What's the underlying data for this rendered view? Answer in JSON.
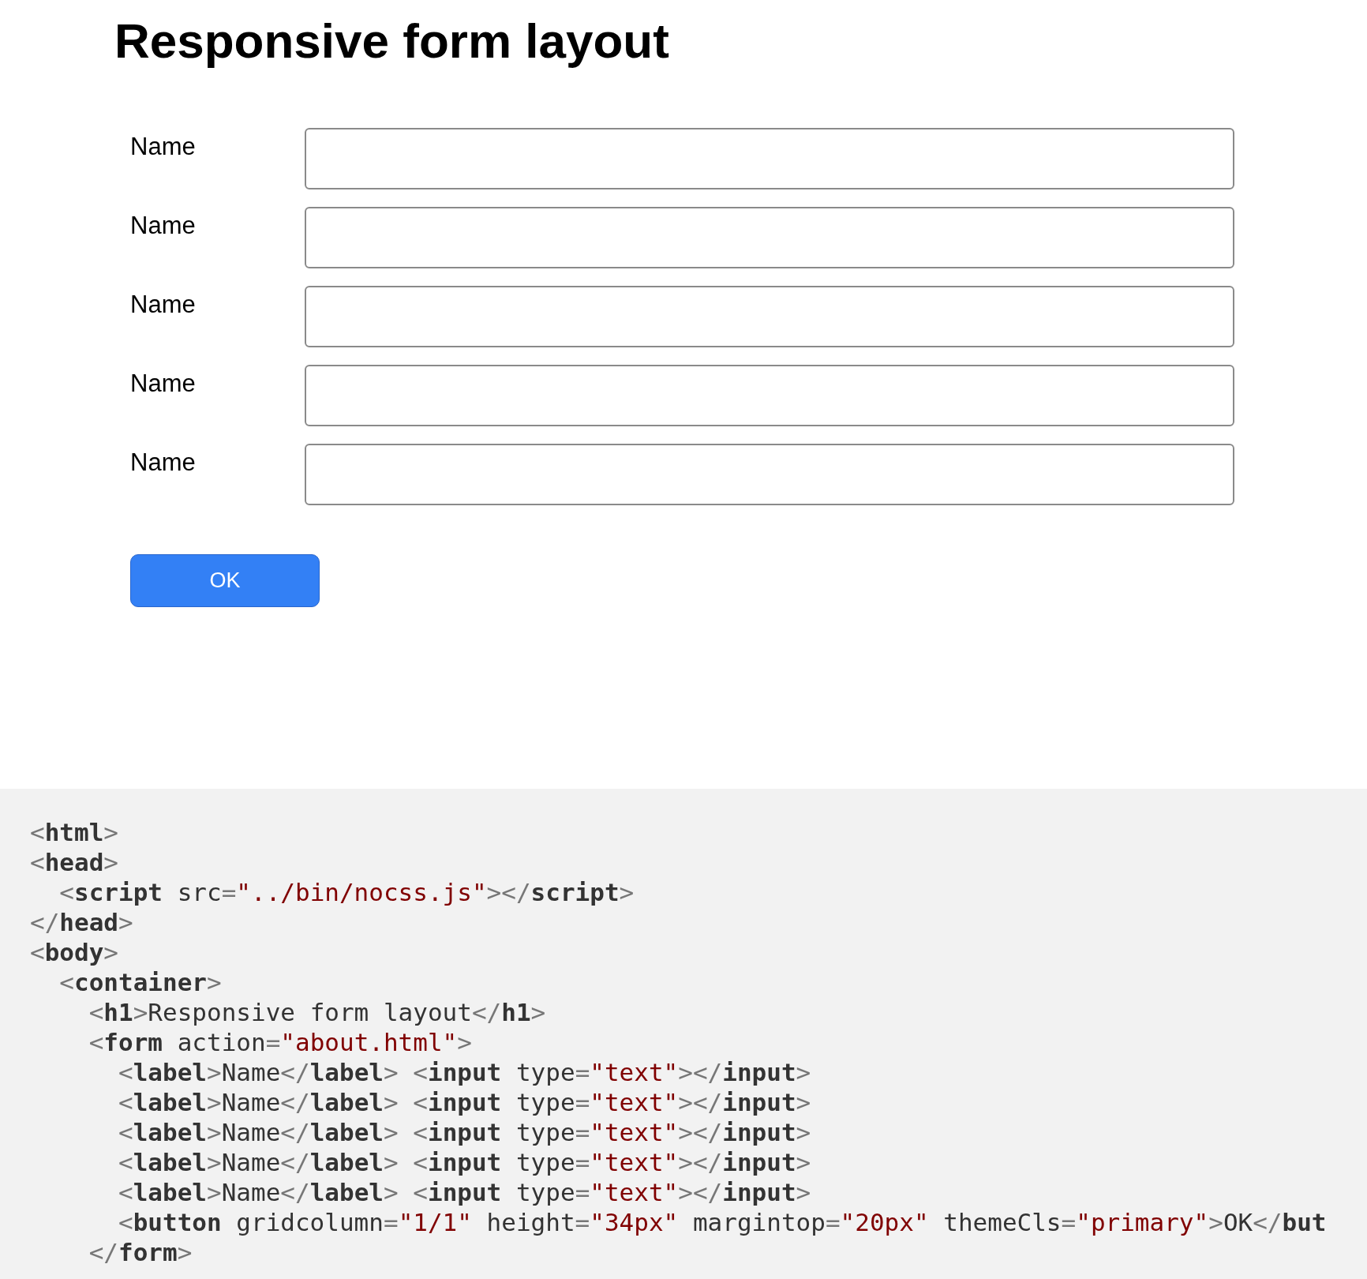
{
  "title": "Responsive form layout",
  "form": {
    "fields": [
      {
        "label": "Name"
      },
      {
        "label": "Name"
      },
      {
        "label": "Name"
      },
      {
        "label": "Name"
      },
      {
        "label": "Name"
      }
    ],
    "button": {
      "label": "OK"
    }
  },
  "code": {
    "lines": [
      [
        {
          "kind": "punct",
          "text": "<"
        },
        {
          "kind": "tag",
          "text": "html"
        },
        {
          "kind": "punct",
          "text": ">"
        }
      ],
      [
        {
          "kind": "punct",
          "text": "<"
        },
        {
          "kind": "tag",
          "text": "head"
        },
        {
          "kind": "punct",
          "text": ">"
        }
      ],
      [
        {
          "kind": "punct",
          "text": "  <"
        },
        {
          "kind": "tag",
          "text": "script"
        },
        {
          "kind": "attr",
          "text": " src"
        },
        {
          "kind": "punct",
          "text": "="
        },
        {
          "kind": "string",
          "text": "\"../bin/nocss.js\""
        },
        {
          "kind": "punct",
          "text": "></"
        },
        {
          "kind": "tag",
          "text": "script"
        },
        {
          "kind": "punct",
          "text": ">"
        }
      ],
      [
        {
          "kind": "punct",
          "text": "</"
        },
        {
          "kind": "tag",
          "text": "head"
        },
        {
          "kind": "punct",
          "text": ">"
        }
      ],
      [
        {
          "kind": "punct",
          "text": "<"
        },
        {
          "kind": "tag",
          "text": "body"
        },
        {
          "kind": "punct",
          "text": ">"
        }
      ],
      [
        {
          "kind": "punct",
          "text": "  <"
        },
        {
          "kind": "tag",
          "text": "container"
        },
        {
          "kind": "punct",
          "text": ">"
        }
      ],
      [
        {
          "kind": "punct",
          "text": "    <"
        },
        {
          "kind": "tag",
          "text": "h1"
        },
        {
          "kind": "punct",
          "text": ">"
        },
        {
          "kind": "text",
          "text": "Responsive form layout"
        },
        {
          "kind": "punct",
          "text": "</"
        },
        {
          "kind": "tag",
          "text": "h1"
        },
        {
          "kind": "punct",
          "text": ">"
        }
      ],
      [
        {
          "kind": "punct",
          "text": "    <"
        },
        {
          "kind": "tag",
          "text": "form"
        },
        {
          "kind": "attr",
          "text": " action"
        },
        {
          "kind": "punct",
          "text": "="
        },
        {
          "kind": "string",
          "text": "\"about.html\""
        },
        {
          "kind": "punct",
          "text": ">"
        }
      ],
      [
        {
          "kind": "punct",
          "text": "      <"
        },
        {
          "kind": "tag",
          "text": "label"
        },
        {
          "kind": "punct",
          "text": ">"
        },
        {
          "kind": "text",
          "text": "Name"
        },
        {
          "kind": "punct",
          "text": "</"
        },
        {
          "kind": "tag",
          "text": "label"
        },
        {
          "kind": "punct",
          "text": "> <"
        },
        {
          "kind": "tag",
          "text": "input"
        },
        {
          "kind": "attr",
          "text": " type"
        },
        {
          "kind": "punct",
          "text": "="
        },
        {
          "kind": "string",
          "text": "\"text\""
        },
        {
          "kind": "punct",
          "text": "></"
        },
        {
          "kind": "tag",
          "text": "input"
        },
        {
          "kind": "punct",
          "text": ">"
        }
      ],
      [
        {
          "kind": "punct",
          "text": "      <"
        },
        {
          "kind": "tag",
          "text": "label"
        },
        {
          "kind": "punct",
          "text": ">"
        },
        {
          "kind": "text",
          "text": "Name"
        },
        {
          "kind": "punct",
          "text": "</"
        },
        {
          "kind": "tag",
          "text": "label"
        },
        {
          "kind": "punct",
          "text": "> <"
        },
        {
          "kind": "tag",
          "text": "input"
        },
        {
          "kind": "attr",
          "text": " type"
        },
        {
          "kind": "punct",
          "text": "="
        },
        {
          "kind": "string",
          "text": "\"text\""
        },
        {
          "kind": "punct",
          "text": "></"
        },
        {
          "kind": "tag",
          "text": "input"
        },
        {
          "kind": "punct",
          "text": ">"
        }
      ],
      [
        {
          "kind": "punct",
          "text": "      <"
        },
        {
          "kind": "tag",
          "text": "label"
        },
        {
          "kind": "punct",
          "text": ">"
        },
        {
          "kind": "text",
          "text": "Name"
        },
        {
          "kind": "punct",
          "text": "</"
        },
        {
          "kind": "tag",
          "text": "label"
        },
        {
          "kind": "punct",
          "text": "> <"
        },
        {
          "kind": "tag",
          "text": "input"
        },
        {
          "kind": "attr",
          "text": " type"
        },
        {
          "kind": "punct",
          "text": "="
        },
        {
          "kind": "string",
          "text": "\"text\""
        },
        {
          "kind": "punct",
          "text": "></"
        },
        {
          "kind": "tag",
          "text": "input"
        },
        {
          "kind": "punct",
          "text": ">"
        }
      ],
      [
        {
          "kind": "punct",
          "text": "      <"
        },
        {
          "kind": "tag",
          "text": "label"
        },
        {
          "kind": "punct",
          "text": ">"
        },
        {
          "kind": "text",
          "text": "Name"
        },
        {
          "kind": "punct",
          "text": "</"
        },
        {
          "kind": "tag",
          "text": "label"
        },
        {
          "kind": "punct",
          "text": "> <"
        },
        {
          "kind": "tag",
          "text": "input"
        },
        {
          "kind": "attr",
          "text": " type"
        },
        {
          "kind": "punct",
          "text": "="
        },
        {
          "kind": "string",
          "text": "\"text\""
        },
        {
          "kind": "punct",
          "text": "></"
        },
        {
          "kind": "tag",
          "text": "input"
        },
        {
          "kind": "punct",
          "text": ">"
        }
      ],
      [
        {
          "kind": "punct",
          "text": "      <"
        },
        {
          "kind": "tag",
          "text": "label"
        },
        {
          "kind": "punct",
          "text": ">"
        },
        {
          "kind": "text",
          "text": "Name"
        },
        {
          "kind": "punct",
          "text": "</"
        },
        {
          "kind": "tag",
          "text": "label"
        },
        {
          "kind": "punct",
          "text": "> <"
        },
        {
          "kind": "tag",
          "text": "input"
        },
        {
          "kind": "attr",
          "text": " type"
        },
        {
          "kind": "punct",
          "text": "="
        },
        {
          "kind": "string",
          "text": "\"text\""
        },
        {
          "kind": "punct",
          "text": "></"
        },
        {
          "kind": "tag",
          "text": "input"
        },
        {
          "kind": "punct",
          "text": ">"
        }
      ],
      [
        {
          "kind": "punct",
          "text": "      <"
        },
        {
          "kind": "tag",
          "text": "button"
        },
        {
          "kind": "attr",
          "text": " gridcolumn"
        },
        {
          "kind": "punct",
          "text": "="
        },
        {
          "kind": "string",
          "text": "\"1/1\""
        },
        {
          "kind": "attr",
          "text": " height"
        },
        {
          "kind": "punct",
          "text": "="
        },
        {
          "kind": "string",
          "text": "\"34px\""
        },
        {
          "kind": "attr",
          "text": " margintop"
        },
        {
          "kind": "punct",
          "text": "="
        },
        {
          "kind": "string",
          "text": "\"20px\""
        },
        {
          "kind": "attr",
          "text": " themeCls"
        },
        {
          "kind": "punct",
          "text": "="
        },
        {
          "kind": "string",
          "text": "\"primary\""
        },
        {
          "kind": "punct",
          "text": ">"
        },
        {
          "kind": "text",
          "text": "OK"
        },
        {
          "kind": "punct",
          "text": "</"
        },
        {
          "kind": "tag",
          "text": "but"
        }
      ],
      [
        {
          "kind": "punct",
          "text": "    </"
        },
        {
          "kind": "tag",
          "text": "form"
        },
        {
          "kind": "punct",
          "text": ">"
        }
      ]
    ]
  }
}
